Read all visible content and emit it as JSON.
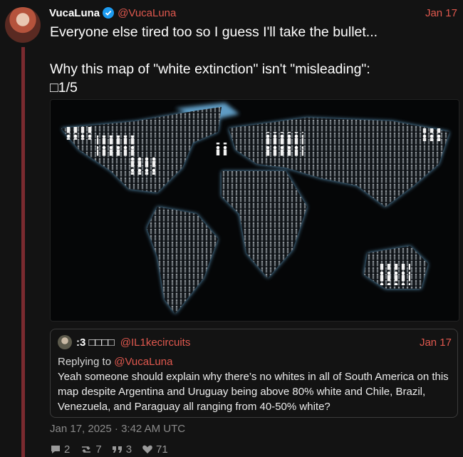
{
  "post": {
    "display_name": "VucaLuna",
    "handle": "@VucaLuna",
    "date": "Jan 17",
    "text": "Everyone else tired too so I guess I'll take the bullet...\n\nWhy this map of \"white extinction\" isn't \"misleading\":\n□1/5"
  },
  "quote": {
    "display_name": ":3 □□□□",
    "handle": "@IL1kecircuits",
    "date": "Jan 17",
    "replying_label": "Replying to",
    "replying_to": "@VucaLuna",
    "text": "Yeah someone should explain why there’s no whites in all of South America on this map despite Argentina and Uruguay being above 80% white and Chile, Brazil, Venezuela, and Paraguay all ranging from 40-50% white?"
  },
  "timestamp": "Jan 17, 2025 · 3:42 AM UTC",
  "stats": {
    "replies": "2",
    "reposts": "7",
    "quotes": "3",
    "likes": "71"
  },
  "colors": {
    "accent": "#e0584e",
    "verified": "#1d9bf0",
    "thread_line": "#7a2a2f",
    "ocean": "#050607",
    "land_glow": "#6fb7e6"
  },
  "icons": [
    "verified-badge-icon",
    "comment-icon",
    "repost-icon",
    "quote-icon",
    "heart-icon"
  ]
}
